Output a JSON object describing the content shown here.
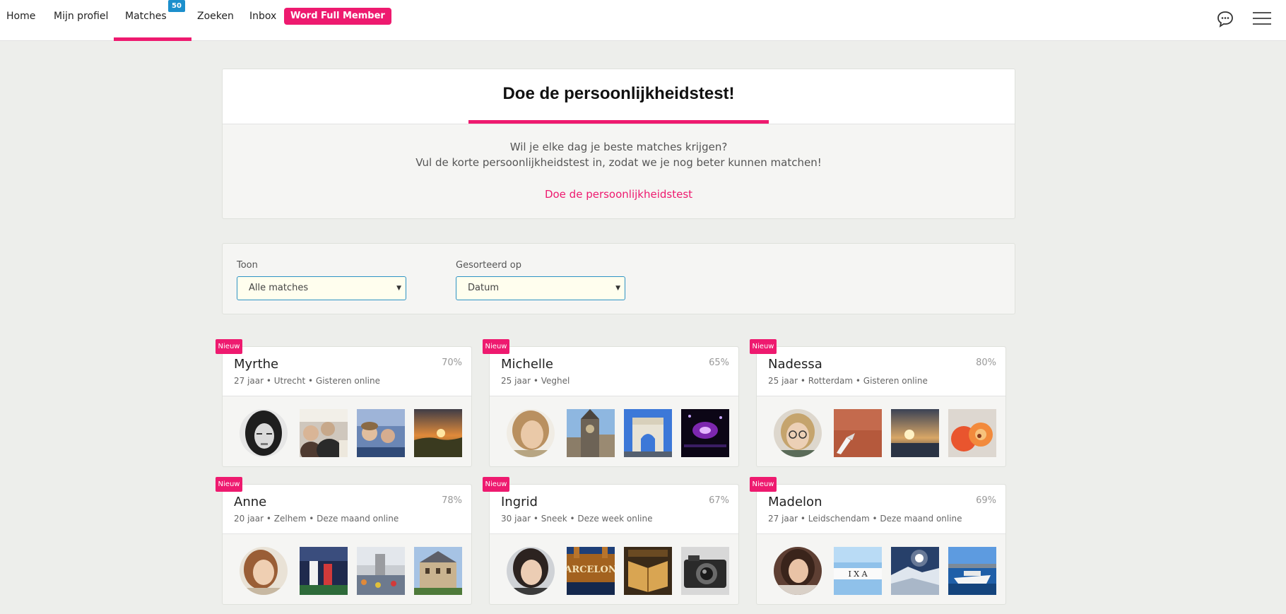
{
  "nav": {
    "items": [
      "Home",
      "Mijn profiel",
      "Matches",
      "Zoeken",
      "Inbox"
    ],
    "matches_badge": "50",
    "cta": "Word Full Member",
    "icons": [
      "chat-bubble-icon",
      "hamburger-menu-icon"
    ]
  },
  "personality": {
    "title": "Doe de persoonlijkheidstest!",
    "line1": "Wil je elke dag je beste matches krijgen?",
    "line2": "Vul de korte persoonlijkheidstest in, zodat we je nog beter kunnen matchen!",
    "link": "Doe de persoonlijkheidstest"
  },
  "filters": {
    "show_label": "Toon",
    "show_value": "Alle matches",
    "sort_label": "Gesorteerd op",
    "sort_value": "Datum"
  },
  "cards": [
    {
      "badge": "Nieuw",
      "name": "Myrthe",
      "meta": "27 jaar • Utrecht • Gisteren online",
      "match": "70%"
    },
    {
      "badge": "Nieuw",
      "name": "Michelle",
      "meta": "25 jaar • Veghel",
      "match": "65%"
    },
    {
      "badge": "Nieuw",
      "name": "Nadessa",
      "meta": "25 jaar • Rotterdam • Gisteren online",
      "match": "80%"
    },
    {
      "badge": "Nieuw",
      "name": "Anne",
      "meta": "20 jaar • Zelhem • Deze maand online",
      "match": "78%"
    },
    {
      "badge": "Nieuw",
      "name": "Ingrid",
      "meta": "30 jaar • Sneek • Deze week online",
      "match": "67%"
    },
    {
      "badge": "Nieuw",
      "name": "Madelon",
      "meta": "27 jaar • Leidschendam • Deze maand online",
      "match": "69%"
    }
  ],
  "photo_text": {
    "ingrid_2": "ARCELON",
    "madelon_2": "I  X  A"
  },
  "colors": {
    "accent": "#ee1a6f",
    "badge_blue": "#1c8fcc",
    "select_border": "#2e93c4",
    "page_bg": "#edeeeb"
  }
}
